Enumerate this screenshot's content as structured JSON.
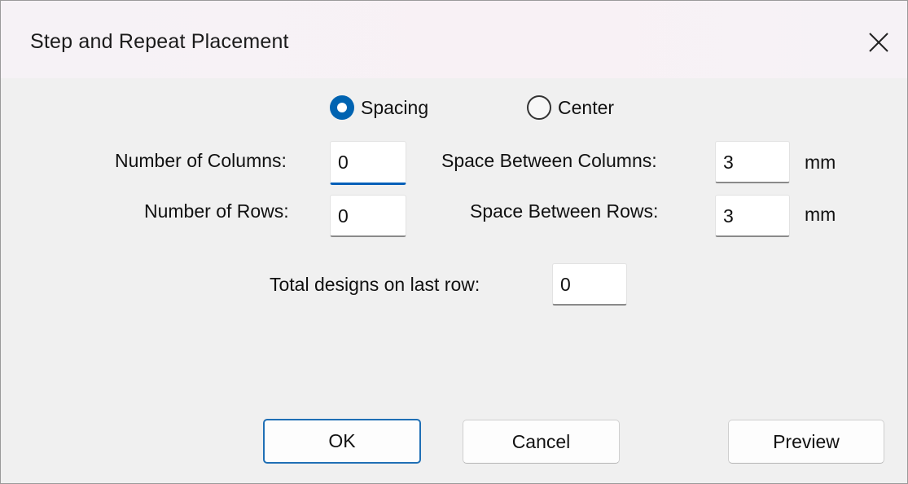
{
  "window": {
    "title": "Step and Repeat Placement",
    "close_icon": "close-icon"
  },
  "mode": {
    "options": [
      {
        "label": "Spacing",
        "selected": true
      },
      {
        "label": "Center",
        "selected": false
      }
    ]
  },
  "fields": {
    "columns": {
      "label": "Number of Columns:",
      "value": "0"
    },
    "rows": {
      "label": "Number of Rows:",
      "value": "0"
    },
    "space_columns": {
      "label": "Space Between Columns:",
      "value": "3",
      "unit": "mm"
    },
    "space_rows": {
      "label": "Space Between Rows:",
      "value": "3",
      "unit": "mm"
    },
    "last_row": {
      "label": "Total designs on last row:",
      "value": "0"
    }
  },
  "buttons": {
    "ok": "OK",
    "cancel": "Cancel",
    "preview": "Preview"
  },
  "colors": {
    "accent": "#0063b1",
    "background": "#f0f0f0"
  }
}
